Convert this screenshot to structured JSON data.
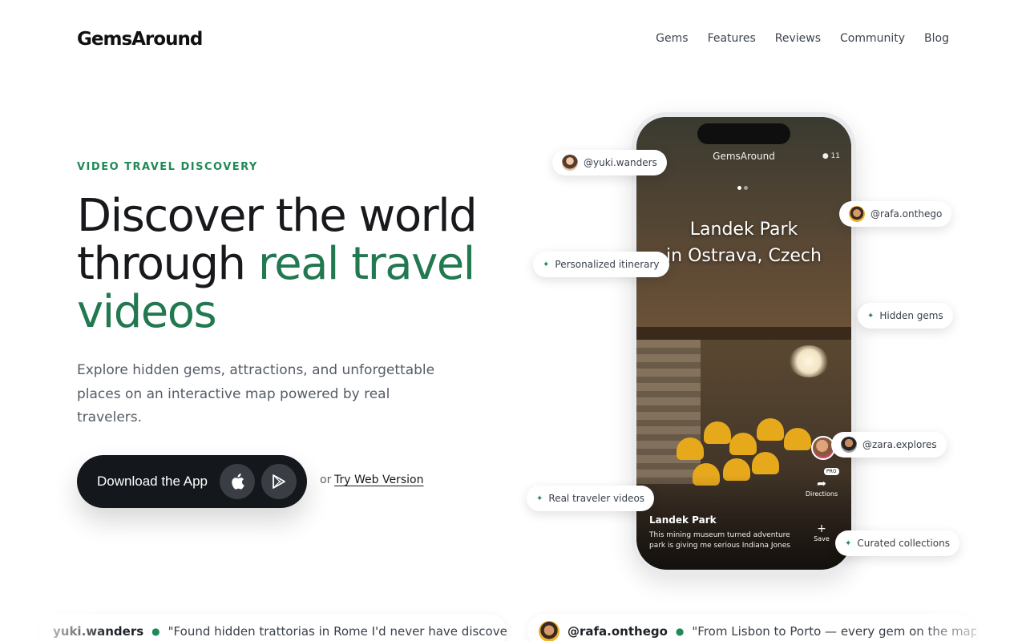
{
  "brand": {
    "logo_text": "GemsAround",
    "accent_color": "#22784f",
    "eyebrow_color": "#1f8a57"
  },
  "nav": {
    "items": [
      "Gems",
      "Features",
      "Reviews",
      "Community",
      "Blog"
    ]
  },
  "hero": {
    "eyebrow": "VIDEO TRAVEL DISCOVERY",
    "headline_part1": "Discover the world through ",
    "headline_accent": "real travel videos",
    "description": "Explore hidden gems, attractions, and unforgettable places on an interactive map powered by real travelers.",
    "cta_label": "Download the App",
    "cta_icons": [
      "apple-icon",
      "google-play-icon"
    ],
    "or_text": "or",
    "web_link": "Try Web Version"
  },
  "phone": {
    "app_title": "GemsAround",
    "pin_count": "11",
    "place_title_line1": "Landek Park",
    "place_title_line2": "in Ostrava, Czech",
    "video_name": "Landek Park",
    "video_caption": "This mining museum turned adventure park is giving me serious Indiana Jones",
    "pro_badge": "PRO",
    "actions": {
      "directions": "Directions",
      "save": "Save"
    }
  },
  "pills": {
    "yuki": "@yuki.wanders",
    "rafa": "@rafa.onthego",
    "itinerary": "Personalized itinerary",
    "hidden_gems": "Hidden gems",
    "zara": "@zara.explores",
    "real_videos": "Real traveler videos",
    "collections": "Curated collections"
  },
  "testimonials": [
    {
      "handle": "yuki.wanders",
      "quote": "\"Found hidden trattorias in Rome I'd never have discovered alone\""
    },
    {
      "handle": "@rafa.onthego",
      "quote": "\"From Lisbon to Porto — every gem on the map is the re"
    }
  ]
}
